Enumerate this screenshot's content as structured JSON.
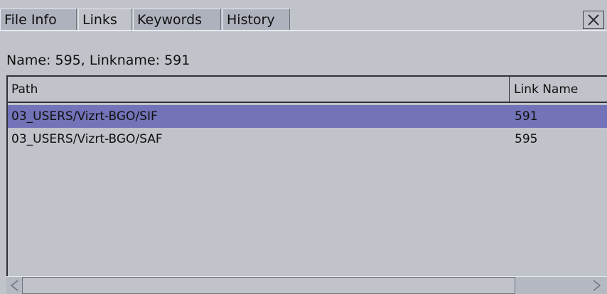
{
  "tabs": [
    {
      "label": "File Info",
      "active": false
    },
    {
      "label": "Links",
      "active": true
    },
    {
      "label": "Keywords",
      "active": false
    },
    {
      "label": "History",
      "active": false
    }
  ],
  "close_icon": "close-icon",
  "info_line": "Name: 595, Linkname: 591",
  "table": {
    "columns": [
      "Path",
      "Link Name"
    ],
    "rows": [
      {
        "path": "03_USERS/Vizrt-BGO/SIF",
        "link_name": "591",
        "selected": true
      },
      {
        "path": "03_USERS/Vizrt-BGO/SAF",
        "link_name": "595",
        "selected": false
      }
    ]
  },
  "scrollbar": {
    "left_icon": "arrow-left-icon",
    "right_icon": "arrow-right-icon"
  },
  "colors": {
    "background": "#c0c3c9",
    "inactive_tab": "#aeb2bd",
    "selection": "#7273b8"
  }
}
